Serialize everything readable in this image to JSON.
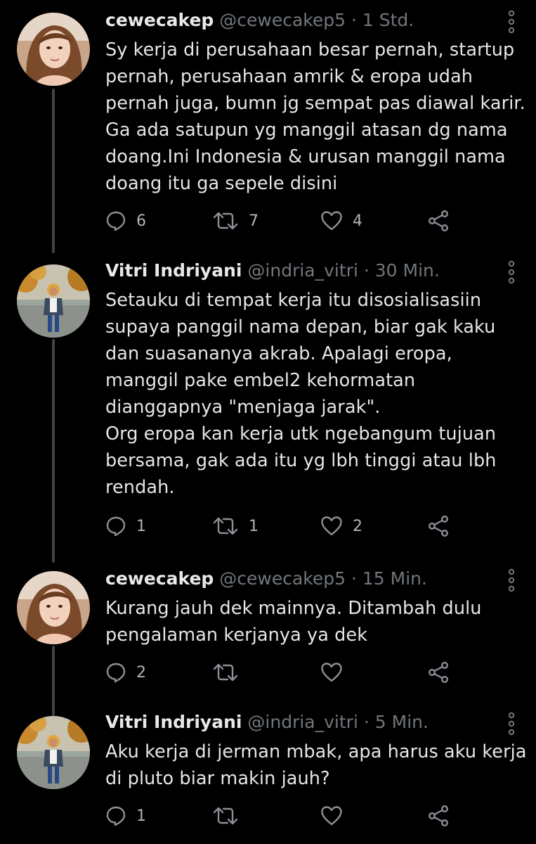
{
  "colors": {
    "background": "#000000",
    "name": "#e7e9ea",
    "meta": "#71767b",
    "body_text": "#e4e6e7",
    "icon": "#8b9096"
  },
  "tweets": [
    {
      "name": "cewecakep",
      "handle": "@cewecakep5",
      "separator": "·",
      "time": "1 Std.",
      "avatar": "avatar-woman-long-hair",
      "lines": [
        "Sy kerja di perusahaan besar pernah, startup",
        "pernah, perusahaan amrik & eropa udah",
        "pernah juga, bumn jg sempat pas diawal karir.",
        "Ga ada satupun yg manggil atasan dg nama",
        "doang.Ini Indonesia & urusan manggil nama",
        "doang itu ga sepele disini"
      ],
      "replies": "6",
      "retweets": "7",
      "likes": "4"
    },
    {
      "name": "Vitri Indriyani",
      "handle": "@indria_vitri",
      "separator": "·",
      "time": "30 Min.",
      "avatar": "avatar-woman-hijab-park",
      "lines": [
        "Setauku di tempat kerja itu disosialisasiin",
        "supaya panggil nama depan, biar gak kaku",
        "dan suasananya akrab. Apalagi eropa,",
        "manggil pake embel2 kehormatan",
        "dianggapnya \"menjaga jarak\".",
        "Org eropa kan kerja utk ngebangum tujuan",
        "bersama, gak ada itu yg lbh tinggi atau lbh",
        "rendah."
      ],
      "replies": "1",
      "retweets": "1",
      "likes": "2"
    },
    {
      "name": "cewecakep",
      "handle": "@cewecakep5",
      "separator": "·",
      "time": "15 Min.",
      "avatar": "avatar-woman-long-hair",
      "lines": [
        "Kurang jauh dek mainnya. Ditambah dulu",
        "pengalaman kerjanya ya dek"
      ],
      "replies": "2",
      "retweets": "",
      "likes": ""
    },
    {
      "name": "Vitri Indriyani",
      "handle": "@indria_vitri",
      "separator": "·",
      "time": "5 Min.",
      "avatar": "avatar-woman-hijab-park",
      "lines": [
        "Aku kerja di jerman mbak, apa harus aku kerja",
        "di pluto biar makin jauh?"
      ],
      "replies": "1",
      "retweets": "",
      "likes": ""
    }
  ]
}
